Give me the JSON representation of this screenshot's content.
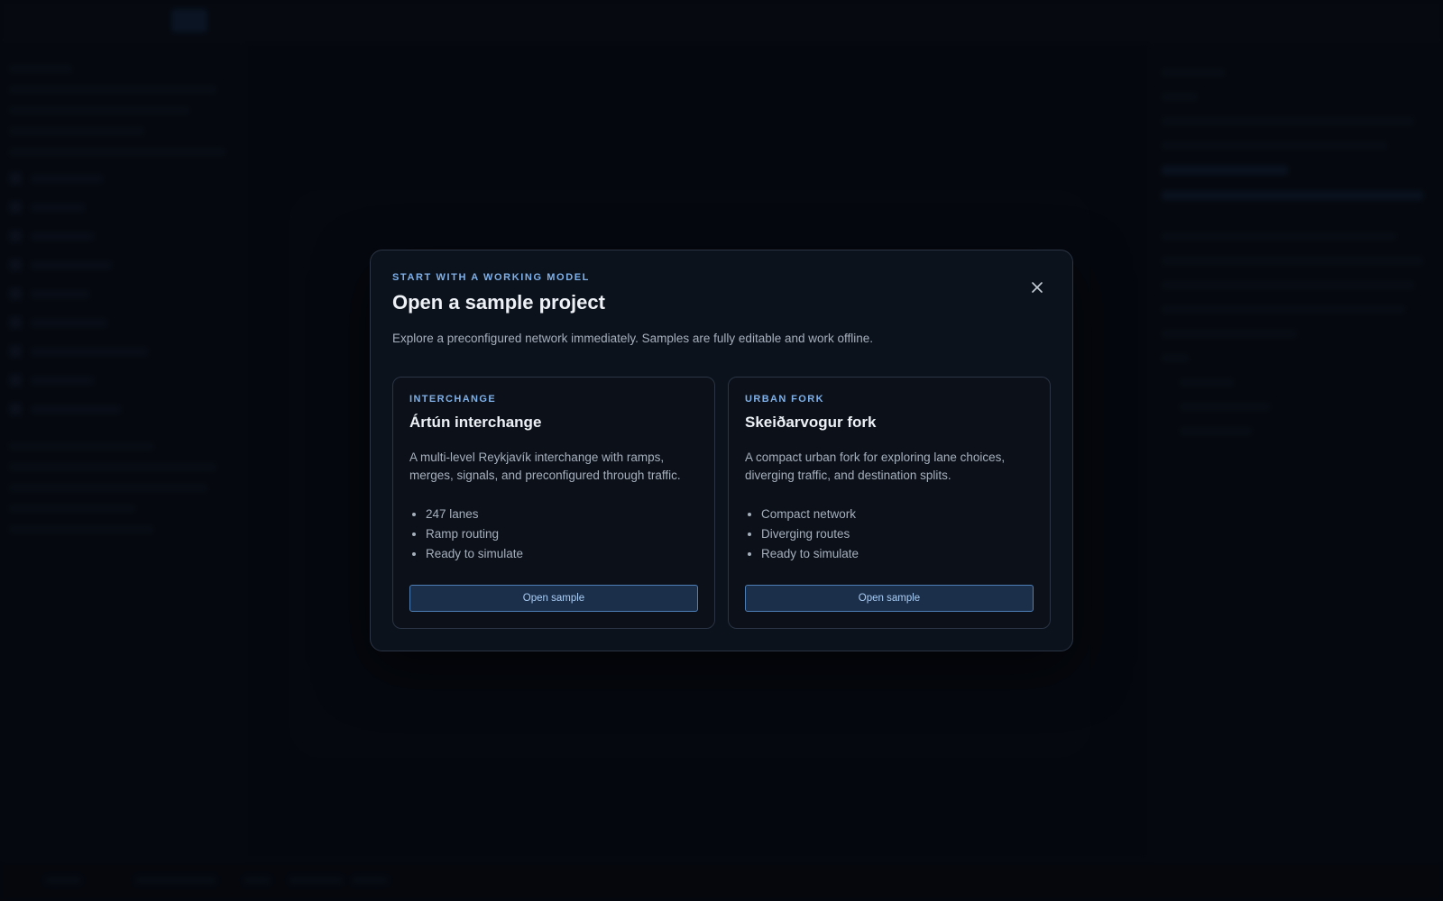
{
  "modal": {
    "eyebrow": "START WITH A WORKING MODEL",
    "title": "Open a sample project",
    "description": "Explore a preconfigured network immediately. Samples are fully editable and work offline.",
    "close_icon": "close-icon"
  },
  "samples": [
    {
      "eyebrow": "INTERCHANGE",
      "title": "Ártún interchange",
      "description": "A multi-level Reykjavík interchange with ramps, merges, signals, and preconfigured through traffic.",
      "features": [
        "247 lanes",
        "Ramp routing",
        "Ready to simulate"
      ],
      "button_label": "Open sample"
    },
    {
      "eyebrow": "URBAN FORK",
      "title": "Skeiðarvogur fork",
      "description": "A compact urban fork for exploring lane choices, diverging traffic, and destination splits.",
      "features": [
        "Compact network",
        "Diverging routes",
        "Ready to simulate"
      ],
      "button_label": "Open sample"
    }
  ],
  "colors": {
    "accent": "#7fb0e8",
    "modal_bg": "#0c121c",
    "button_bg": "#1c2f4a",
    "button_border": "#4f7fb7"
  }
}
